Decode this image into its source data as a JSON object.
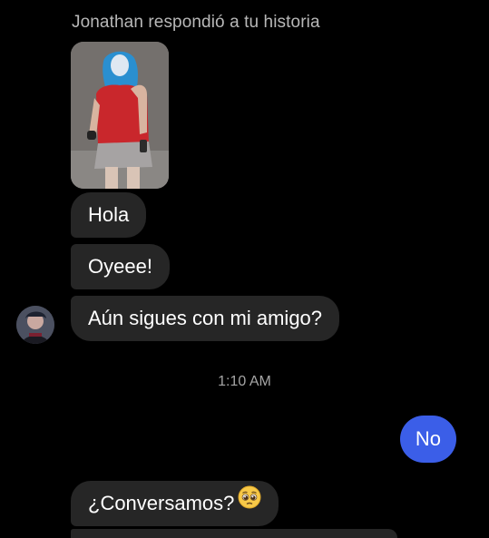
{
  "conversation": {
    "reply_header": "Jonathan respondió a tu historia",
    "messages": [
      {
        "text": "Hola"
      },
      {
        "text": "Oyeee!"
      },
      {
        "text": "Aún sigues con mi amigo?"
      }
    ],
    "timestamp": "1:10 AM",
    "outgoing": {
      "text": "No"
    },
    "last_incoming": {
      "text": "¿Conversamos?",
      "emoji": "pleading-face-emoji"
    }
  },
  "colors": {
    "background": "#000000",
    "incoming_bubble": "#262626",
    "outgoing_bubble": "#3b5ee8",
    "muted_text": "#b8b8b8"
  }
}
